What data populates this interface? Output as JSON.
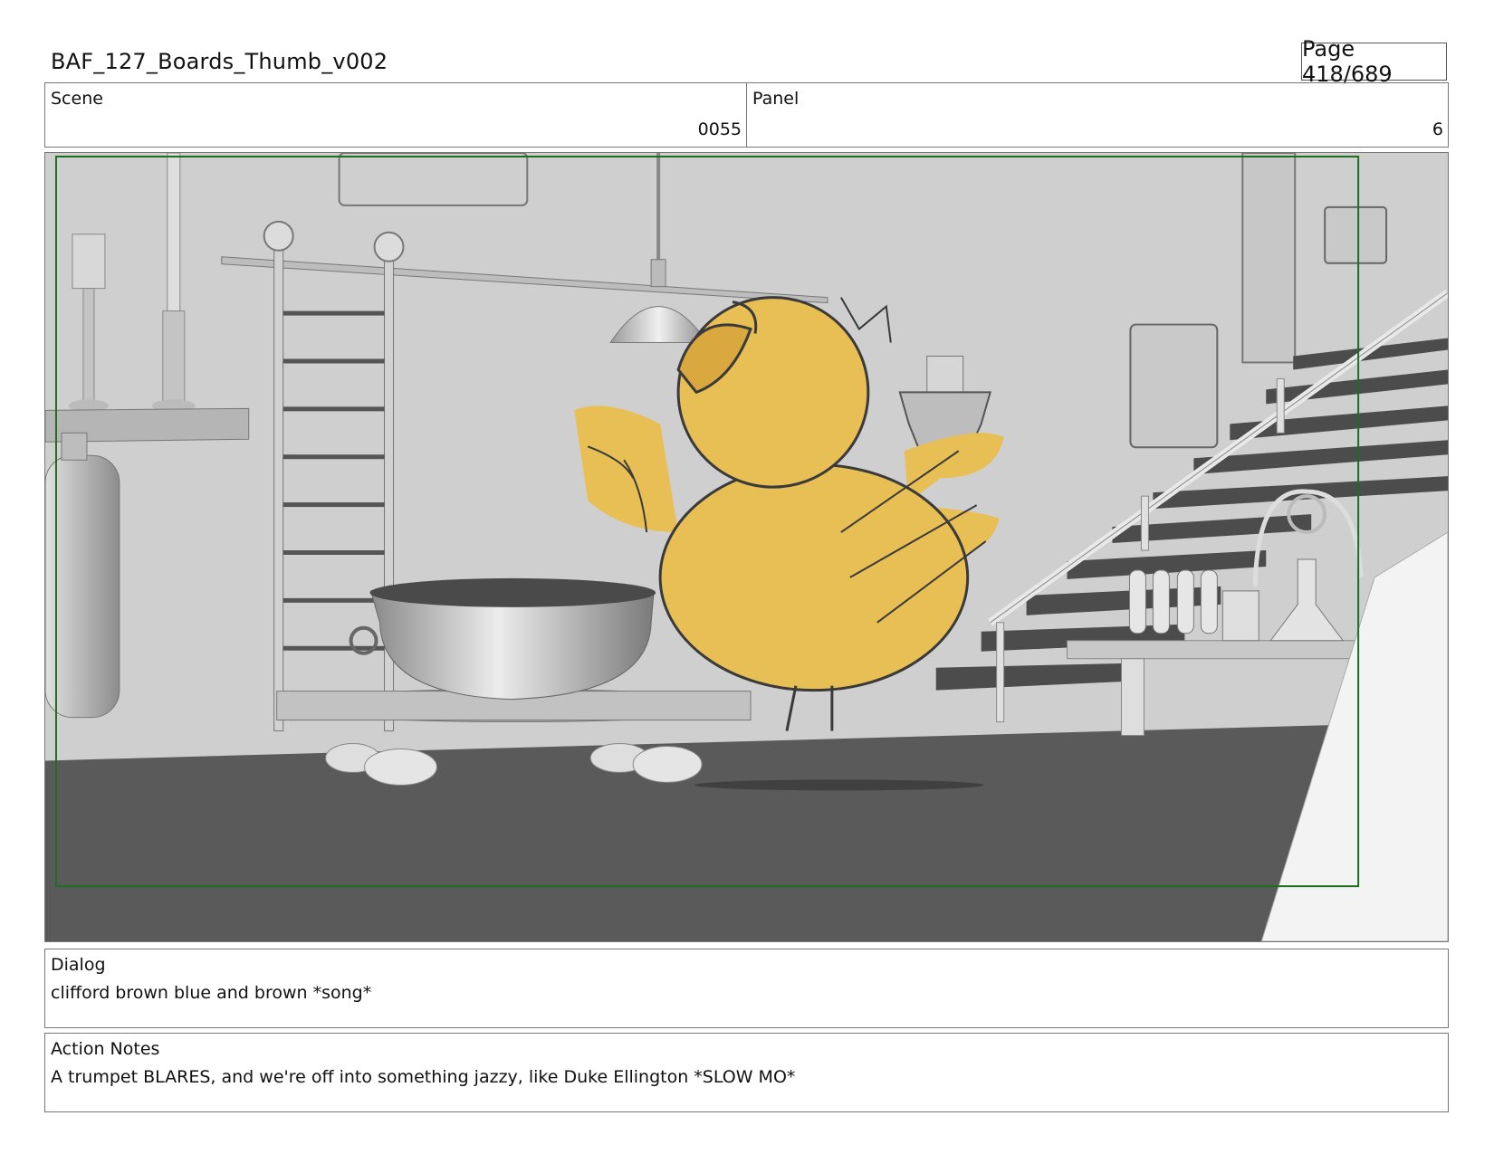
{
  "header": {
    "title": "BAF_127_Boards_Thumb_v002",
    "page": "Page 418/689"
  },
  "info": {
    "scene_label": "Scene",
    "scene_value": "0055",
    "panel_label": "Panel",
    "panel_value": "6"
  },
  "frame": {
    "safe_area_color": "#1f6e1f",
    "character_color": "#e8bf55",
    "floor_color": "#5a5a5a",
    "wall_color": "#cdcdcd",
    "icons": [
      "owl-character-sketch",
      "cauldron",
      "ladder",
      "candlestick",
      "pendant-lamp",
      "staircase",
      "lab-glassware",
      "tank"
    ]
  },
  "dialog": {
    "label": "Dialog",
    "text": "clifford brown blue and brown *song*"
  },
  "action": {
    "label": "Action Notes",
    "text": "A trumpet BLARES, and we're off into something jazzy, like Duke Ellington *SLOW MO*"
  }
}
